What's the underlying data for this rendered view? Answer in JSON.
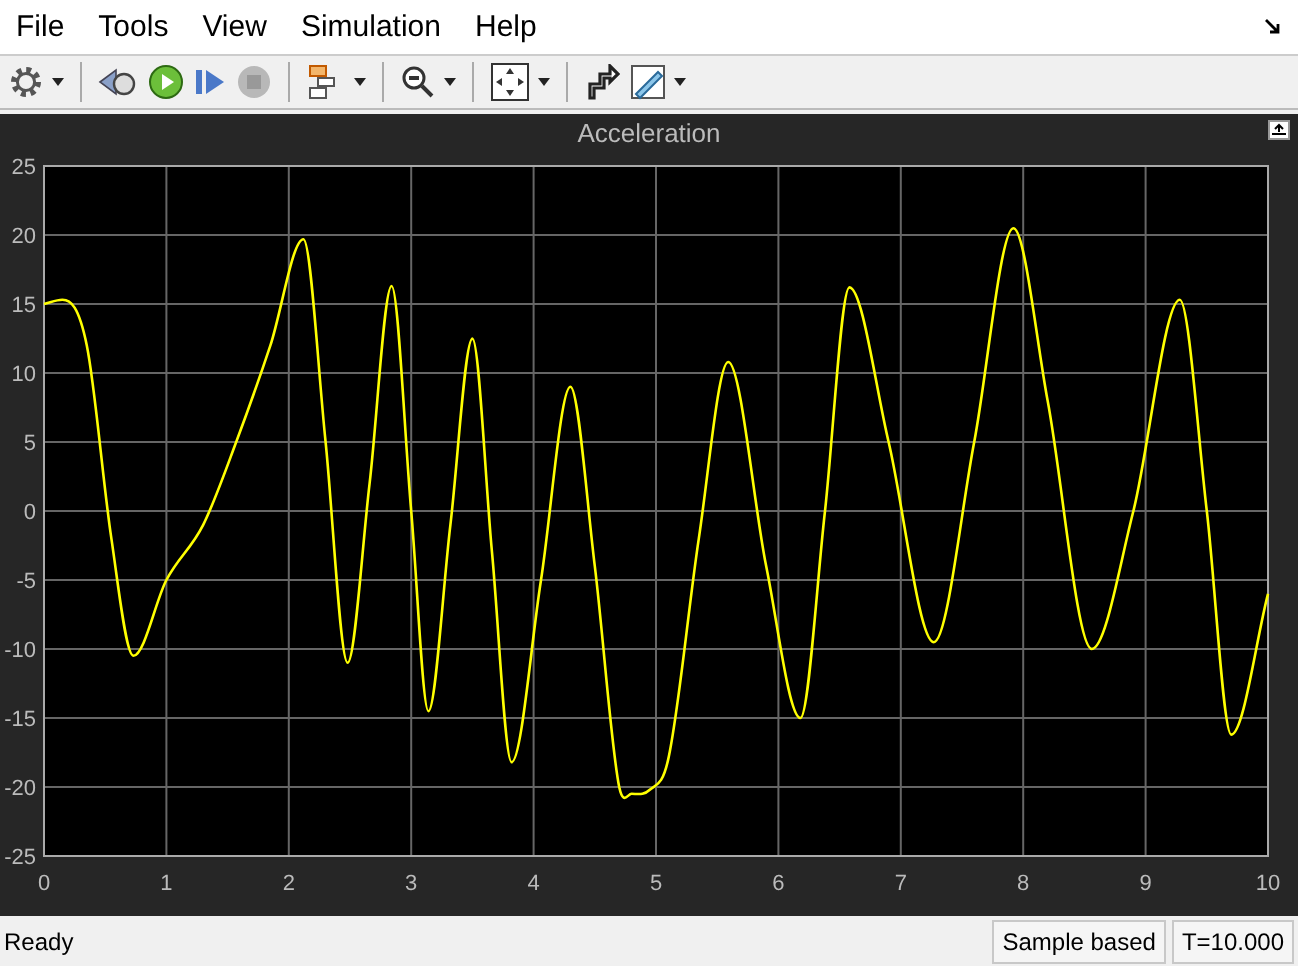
{
  "menu": [
    "File",
    "Tools",
    "View",
    "Simulation",
    "Help"
  ],
  "toolbar": [
    {
      "kind": "gear"
    },
    {
      "kind": "caret"
    },
    {
      "kind": "sep"
    },
    {
      "kind": "step-back"
    },
    {
      "kind": "run"
    },
    {
      "kind": "step-forward"
    },
    {
      "kind": "stop",
      "disabled": true
    },
    {
      "kind": "sep"
    },
    {
      "kind": "layout"
    },
    {
      "kind": "caret"
    },
    {
      "kind": "sep"
    },
    {
      "kind": "zoom"
    },
    {
      "kind": "caret"
    },
    {
      "kind": "sep"
    },
    {
      "kind": "fit"
    },
    {
      "kind": "caret"
    },
    {
      "kind": "sep"
    },
    {
      "kind": "highlight"
    },
    {
      "kind": "ruler"
    },
    {
      "kind": "caret"
    }
  ],
  "plot": {
    "chart_data": {
      "type": "line",
      "title": "Acceleration",
      "x": [
        0,
        0.15,
        0.35,
        0.55,
        0.73,
        1.0,
        1.3,
        1.57,
        1.85,
        2.12,
        2.3,
        2.48,
        2.66,
        2.84,
        3.0,
        3.14,
        3.32,
        3.5,
        3.66,
        3.82,
        4.06,
        4.3,
        4.5,
        4.7,
        4.8,
        4.95,
        5.1,
        5.35,
        5.59,
        5.9,
        6.18,
        6.38,
        6.58,
        6.9,
        7.27,
        7.6,
        7.92,
        8.2,
        8.56,
        8.9,
        9.28,
        9.5,
        9.7,
        10
      ],
      "grid": true,
      "series": [
        {
          "color": "#ffff00",
          "values": [
            15,
            15.3,
            12,
            -2,
            -10.5,
            -5,
            -1,
            5,
            12,
            19.7,
            5,
            -11,
            2,
            16.3,
            0,
            -14.5,
            -1,
            12.5,
            -3,
            -18.2,
            -5,
            9,
            -4,
            -20,
            -20.5,
            -20.2,
            -18,
            -2,
            10.8,
            -4,
            -15,
            0,
            16.2,
            5,
            -9.5,
            5,
            20.5,
            8,
            -10,
            0,
            15.3,
            0,
            -16.2,
            -6
          ]
        }
      ],
      "xlim": [
        0,
        10
      ],
      "ylim": [
        -25,
        25
      ],
      "xticks": [
        0,
        1,
        2,
        3,
        4,
        5,
        6,
        7,
        8,
        9,
        10
      ],
      "yticks": [
        -25,
        -20,
        -15,
        -10,
        -5,
        0,
        5,
        10,
        15,
        20,
        25
      ]
    }
  },
  "status": {
    "message": "Ready",
    "mode": "Sample based",
    "time": "T=10.000"
  }
}
